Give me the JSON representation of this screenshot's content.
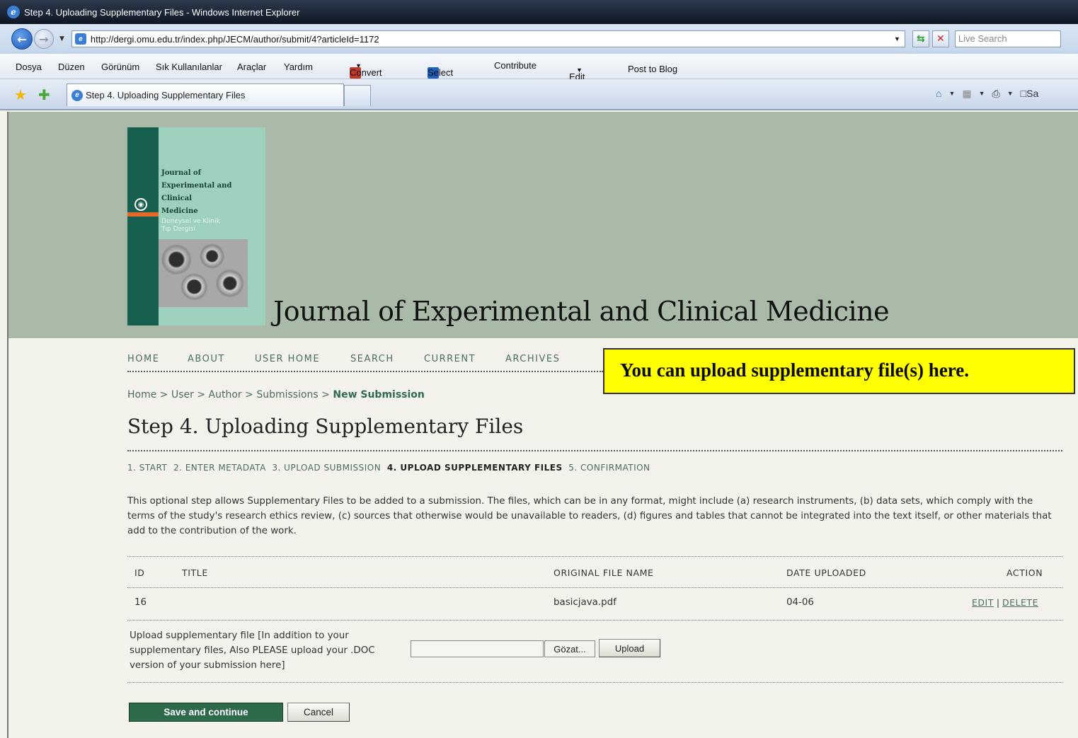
{
  "window": {
    "title": "Step 4. Uploading Supplementary Files - Windows Internet Explorer"
  },
  "address_bar": {
    "url": "http://dergi.omu.edu.tr/index.php/JECM/author/submit/4?articleId=1172",
    "search_placeholder": "Live Search"
  },
  "menu": {
    "items": [
      "Dosya",
      "Düzen",
      "Görünüm",
      "Sık Kullanılanlar",
      "Araçlar",
      "Yardım"
    ],
    "toolbar": {
      "convert": "Convert",
      "select": "Select",
      "contribute": "Contribute",
      "edit": "Edit",
      "post_to_blog": "Post to Blog"
    }
  },
  "tabs": {
    "active_label": "Step 4. Uploading Supplementary Files",
    "command_truncated": "Sa"
  },
  "header": {
    "cover_title_lines": [
      "Journal of",
      "Experimental and",
      "Clinical",
      "Medicine"
    ],
    "cover_subtitle_lines": [
      "Deneysel ve Klinik",
      "Tıp Dergisi"
    ],
    "journal_title": "Journal of Experimental and Clinical Medicine"
  },
  "nav": {
    "items": [
      "HOME",
      "ABOUT",
      "USER HOME",
      "SEARCH",
      "CURRENT",
      "ARCHIVES"
    ]
  },
  "callout": {
    "text": "You can upload supplementary file(s) here."
  },
  "breadcrumb": {
    "items": [
      "Home",
      "User",
      "Author",
      "Submissions"
    ],
    "separator": ">",
    "current": "New Submission"
  },
  "page": {
    "title": "Step 4. Uploading Supplementary Files",
    "steps": [
      "1. START",
      "2. ENTER METADATA",
      "3. UPLOAD SUBMISSION",
      "4. UPLOAD SUPPLEMENTARY FILES",
      "5. CONFIRMATION"
    ],
    "intro": "This optional step allows Supplementary Files to be added to a submission. The files, which can be in any format, might include (a) research instruments, (b) data sets, which comply with the terms of the study's research ethics review, (c) sources that otherwise would be unavailable to readers, (d) figures and tables that cannot be integrated into the text itself, or other materials that add to the contribution of the work."
  },
  "table": {
    "columns": [
      "ID",
      "TITLE",
      "ORIGINAL FILE NAME",
      "DATE UPLOADED",
      "ACTION"
    ],
    "rows": [
      {
        "id": "16",
        "title": "",
        "file_name": "basicjava.pdf",
        "date": "04-06",
        "edit": "EDIT",
        "sep": "|",
        "delete": "DELETE"
      }
    ]
  },
  "upload": {
    "label": "Upload supplementary file [In addition to your supplementary files, Also PLEASE upload your .DOC version of your submission here]",
    "browse_label": "Gözat...",
    "upload_label": "Upload"
  },
  "form": {
    "save_label": "Save and continue",
    "cancel_label": "Cancel"
  },
  "colors": {
    "header_bg": "#a9bba8",
    "accent_green": "#2d6a4a",
    "callout_bg": "#ffff00",
    "link": "#4b6e5e"
  }
}
